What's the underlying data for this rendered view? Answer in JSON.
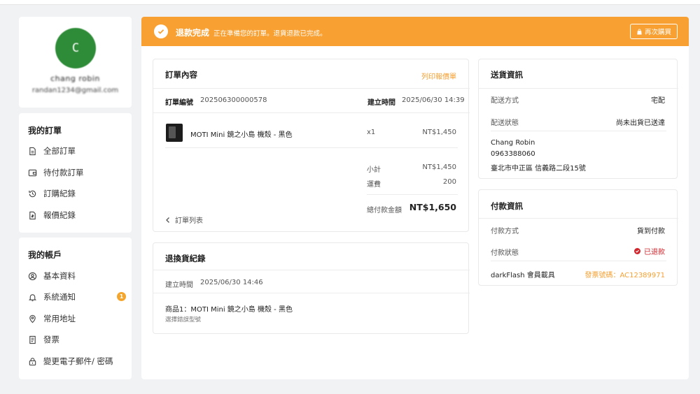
{
  "profile": {
    "avatar_letter": "C",
    "name": "chang robin",
    "email": "randan1234@gmail.com"
  },
  "sidebar": {
    "orders_title": "我的訂單",
    "orders_items": [
      {
        "label": "全部訂單",
        "icon": "document-icon"
      },
      {
        "label": "待付款訂單",
        "icon": "wallet-icon"
      },
      {
        "label": "訂購紀錄",
        "icon": "history-icon"
      },
      {
        "label": "報價紀錄",
        "icon": "quote-icon"
      }
    ],
    "account_title": "我的帳戶",
    "account_items": [
      {
        "label": "基本資料",
        "icon": "user-icon"
      },
      {
        "label": "系統通知",
        "icon": "bell-icon",
        "badge": "1"
      },
      {
        "label": "常用地址",
        "icon": "location-icon"
      },
      {
        "label": "發票",
        "icon": "receipt-icon"
      },
      {
        "label": "變更電子郵件/ 密碼",
        "icon": "lock-icon"
      }
    ]
  },
  "banner": {
    "title": "退款完成",
    "subtitle": "正在準備您的訂單。退貨退款已完成。",
    "rebuy_label": "再次購買",
    "color": "#f8a032"
  },
  "order": {
    "title": "訂單內容",
    "print_label": "列印報價單",
    "number_label": "訂單編號",
    "number": "202506300000578",
    "created_label": "建立時間",
    "created": "2025/06/30 14:39",
    "product_name": "MOTI Mini 鏡之小島 機殼 - 黑色",
    "qty": "x1",
    "price": "NT$1,450",
    "subtotal_label": "小計",
    "subtotal": "NT$1,450",
    "shipping_label": "運費",
    "shipping": "200",
    "total_label": "總付款金額",
    "total": "NT$1,650",
    "back_label": "訂單列表"
  },
  "returns": {
    "title": "退換貨紀錄",
    "created_label": "建立時間",
    "created": "2025/06/30 14:46",
    "item": "商品1：MOTI Mini 鏡之小島 機殼 - 黑色",
    "reason": "選擇錯誤型號"
  },
  "shipping": {
    "title": "送貨資訊",
    "method_label": "配送方式",
    "method": "宅配",
    "status_label": "配送狀態",
    "status": "尚未出貨已送達",
    "recipient_name": "Chang Robin",
    "phone": "0963388060",
    "address": "臺北市中正區 信義路二段15號"
  },
  "payment": {
    "title": "付款資訊",
    "method_label": "付款方式",
    "method": "貨到付款",
    "status_label": "付款狀態",
    "status": "已退款",
    "carrier_label": "darkFlash 會員載具",
    "invoice": "發票號碼：AC12389971"
  },
  "colors": {
    "accent": "#f8a032",
    "refunded": "#d0272e",
    "avatar": "#2e8b37"
  }
}
